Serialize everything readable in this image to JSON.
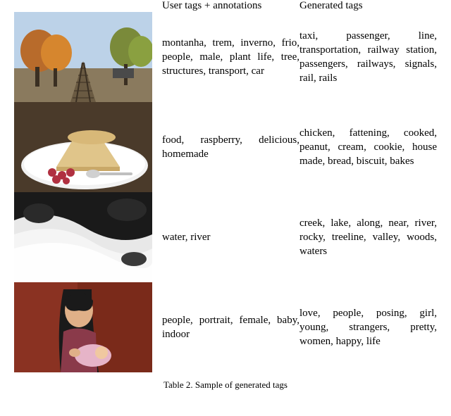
{
  "headers": {
    "user": "User tags + annotations",
    "gen": "Generated tags"
  },
  "rows": [
    {
      "thumb": "railway",
      "user": "montanha, trem, inverno, frio, people, male, plant life, tree, structures, trans­port, car",
      "gen": "taxi, passenger, line, transportation, railway station, passengers, railways, signals, rail, rails"
    },
    {
      "thumb": "dessert",
      "user": "food, raspberry, delicious, homemade",
      "gen": "chicken, fattening, cooked, peanut, cream, cookie, house made, bread, biscuit, bakes"
    },
    {
      "thumb": "river",
      "user": "water, river",
      "gen": "creek, lake, along, near, river, rocky, treeline, val­ley, woods, waters"
    },
    {
      "thumb": "mother",
      "user": "people, portrait, female, baby, indoor",
      "gen": "love, people, posing, girl, young, strangers, pretty, women, happy, life"
    }
  ],
  "caption": "Table 2. Sample of generated tags"
}
